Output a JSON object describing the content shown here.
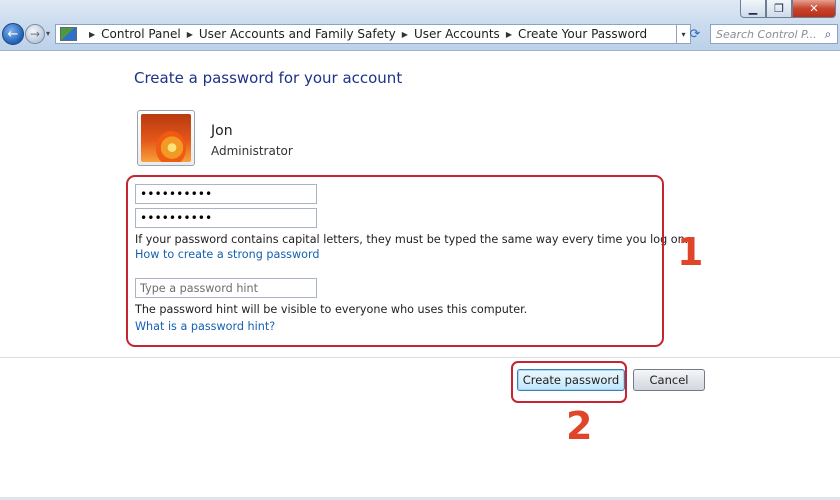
{
  "window": {
    "minimize_glyph": "▁",
    "maximize_glyph": "❐",
    "close_glyph": "✕"
  },
  "nav": {
    "back_glyph": "←",
    "forward_glyph": "→",
    "history_dropdown_glyph": "▾",
    "refresh_glyph": "⟳"
  },
  "breadcrumb": {
    "separator_glyph": "▶",
    "items": [
      {
        "label": "Control Panel"
      },
      {
        "label": "User Accounts and Family Safety"
      },
      {
        "label": "User Accounts"
      },
      {
        "label": "Create Your Password"
      }
    ],
    "dropdown_glyph": "▾"
  },
  "search": {
    "placeholder": "Search Control P...",
    "icon_glyph": "⌕"
  },
  "page": {
    "title": "Create a password for your account"
  },
  "user": {
    "name": "Jon",
    "role": "Administrator"
  },
  "form": {
    "new_password_value": "••••••••••",
    "confirm_password_value": "••••••••••",
    "capital_letters_note": "If your password contains capital letters, they must be typed the same way every time you log on.",
    "strong_password_link": "How to create a strong password",
    "hint_placeholder": "Type a password hint",
    "hint_visibility_note": "The password hint will be visible to everyone who uses this computer.",
    "hint_help_link": "What is a password hint?"
  },
  "buttons": {
    "create_label": "Create password",
    "cancel_label": "Cancel"
  },
  "annotations": {
    "step_1": "1",
    "step_2": "2",
    "highlight_color": "#c62430",
    "number_color": "#e0452a"
  },
  "colors": {
    "title_blue": "#1e3287",
    "link_blue": "#1560b0"
  }
}
